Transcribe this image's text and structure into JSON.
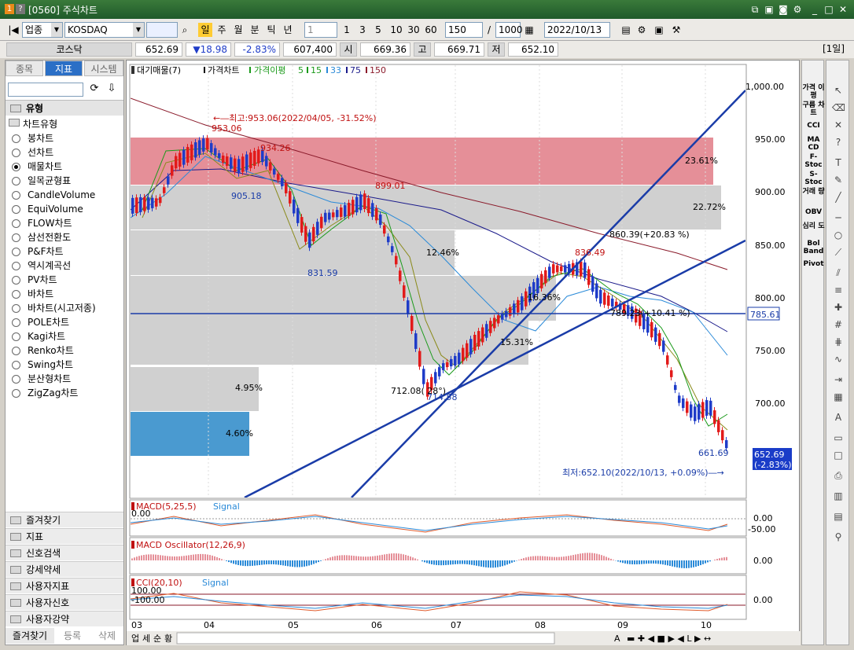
{
  "window": {
    "title": "[0560] 주식차트",
    "icons": [
      "1",
      "?"
    ]
  },
  "toolbar": {
    "market": "업종",
    "symbol": "KOSDAQ",
    "periods": [
      "일",
      "주",
      "월",
      "분",
      "틱",
      "년"
    ],
    "period_sel": "일",
    "num_sel": "1",
    "num_btns": [
      "1",
      "3",
      "5",
      "10",
      "30",
      "60"
    ],
    "count": "150",
    "total": "1000",
    "date": "2022/10/13",
    "slash": "/"
  },
  "quote": {
    "name": "코스닥",
    "price": "652.69",
    "change": "▼18.98",
    "pct": "-2.83%",
    "volume": "607,400",
    "open_label": "시",
    "open": "669.36",
    "high_label": "고",
    "high": "669.71",
    "low_label": "저",
    "low": "652.10",
    "interval": "[1일]"
  },
  "left": {
    "tabs": [
      "종목",
      "지표",
      "시스템"
    ],
    "tab_active": "지표",
    "section": "유형",
    "tree_root": "차트유형",
    "types": [
      "봉차트",
      "선차트",
      "매물차트",
      "일목균형표",
      "CandleVolume",
      "EquiVolume",
      "FLOW차트",
      "삼선전환도",
      "P&F차트",
      "역시계곡선",
      "PV차트",
      "바차트",
      "바차트(시고저종)",
      "POLE차트",
      "Kagi차트",
      "Renko차트",
      "Swing차트",
      "분산형차트",
      "ZigZag차트"
    ],
    "selected_type": "매물차트",
    "folders": [
      "즐겨찾기",
      "지표",
      "신호검색",
      "강세약세",
      "사용자지표",
      "사용자신호",
      "사용자강약"
    ],
    "bottom": [
      "즐겨찾기",
      "등록",
      "삭제"
    ]
  },
  "legend": {
    "items": [
      "대기매물(7)",
      "가격차트",
      "가격이평",
      "5",
      "15",
      "33",
      "75",
      "150"
    ]
  },
  "annotations": {
    "high": "←―최고:953.06(2022/04/05, -31.52%)",
    "low": "최저:652.10(2022/10/13, +0.09%)―→",
    "p953": "953.06",
    "p934": "934.26",
    "p905": "905.18",
    "p899": "899.01",
    "p831": "831.59",
    "p836": "836.49",
    "p712": "712.08( 28°)",
    "p714": "714.58",
    "p661": "661.69",
    "p860": "860.39(+20.83 %)",
    "p789": "789.23(+10.41 %)",
    "pct161": "16.36%",
    "pct153": "15.31%"
  },
  "volume_profile": [
    {
      "pct": "23.61%"
    },
    {
      "pct": "22.72%"
    },
    {
      "pct": "12.46%"
    },
    {
      "pct": "16.36%"
    },
    {
      "pct": "15.31%"
    },
    {
      "pct": "4.95%"
    },
    {
      "pct": "4.60%"
    }
  ],
  "y_axis": [
    "1,000.00",
    "950.00",
    "900.00",
    "850.00",
    "800.00",
    "750.00",
    "700.00"
  ],
  "hline_value": "785.61",
  "last_price": "652.69",
  "last_pct": "(-2.83%)",
  "x_axis": [
    "03",
    "04",
    "05",
    "06",
    "07",
    "08",
    "09",
    "10"
  ],
  "macd": {
    "title": "MACD(5,25,5)",
    "signal": "Signal",
    "y": [
      "0.00",
      "-50.00"
    ],
    "zero": "0.00"
  },
  "osc": {
    "title": "MACD Oscillator(12,26,9)",
    "y": "0.00"
  },
  "cci": {
    "title": "CCI(20,10)",
    "signal": "Signal",
    "y": "0.00",
    "h100": "100.00",
    "l100": "-100.00"
  },
  "bottom_tabs": [
    "업",
    "세",
    "순",
    "황"
  ],
  "nav": [
    "A"
  ],
  "right_labels": [
    "가격\n이평",
    "구름\n차트",
    "CCI",
    "MA\nCD",
    "F-\nStoc",
    "S-\nStoc",
    "거래\n량",
    "OBV",
    "심리\n도",
    "Bol\nBand",
    "Pivot"
  ],
  "colors": {
    "up": "#e21a1a",
    "down": "#1f3cc8",
    "ma5": "#1a9a1a",
    "ma15": "#8a8a1a",
    "ma33": "#2a8ad8",
    "ma75": "#1a1a8a",
    "ma150": "#8a1a2a",
    "accent": "#2b6fc6"
  }
}
